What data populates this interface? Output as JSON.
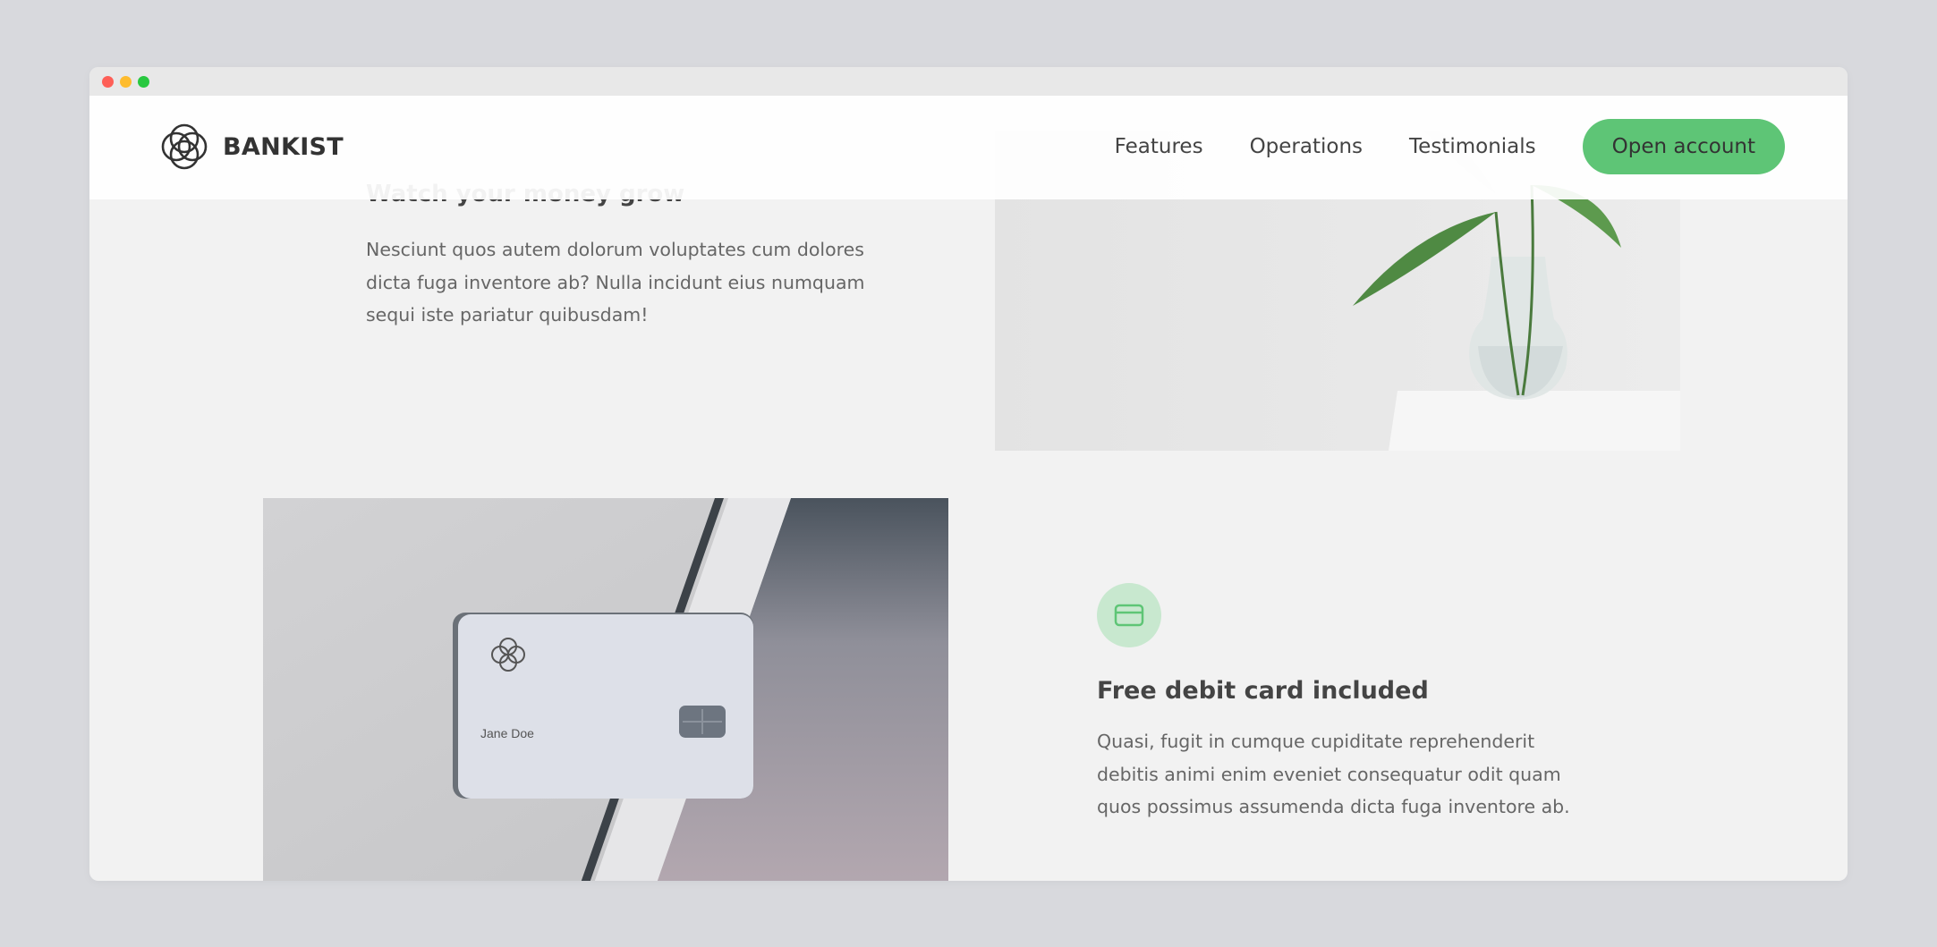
{
  "brand": {
    "name": "BANKIST"
  },
  "nav": {
    "links": [
      "Features",
      "Operations",
      "Testimonials"
    ],
    "cta": "Open account"
  },
  "features": [
    {
      "title": "Watch your money grow",
      "text": "Nesciunt quos autem dolorum voluptates cum dolores dicta fuga inventore ab? Nulla incidunt eius numquam sequi iste pariatur quibusdam!",
      "image": "plant-in-glass-vase"
    },
    {
      "title": "Free debit card included",
      "text": "Quasi, fugit in cumque cupiditate reprehenderit debitis animi enim eveniet consequatur odit quam quos possimus assumenda dicta fuga inventore ab.",
      "icon": "credit-card-icon",
      "image": "debit-card-photo",
      "card_name": "Jane Doe"
    }
  ],
  "colors": {
    "accent": "#5ec576",
    "accent_light": "#c8e8cf",
    "page_bg": "#f2f2f2",
    "outer_bg": "#d8d9dd"
  }
}
